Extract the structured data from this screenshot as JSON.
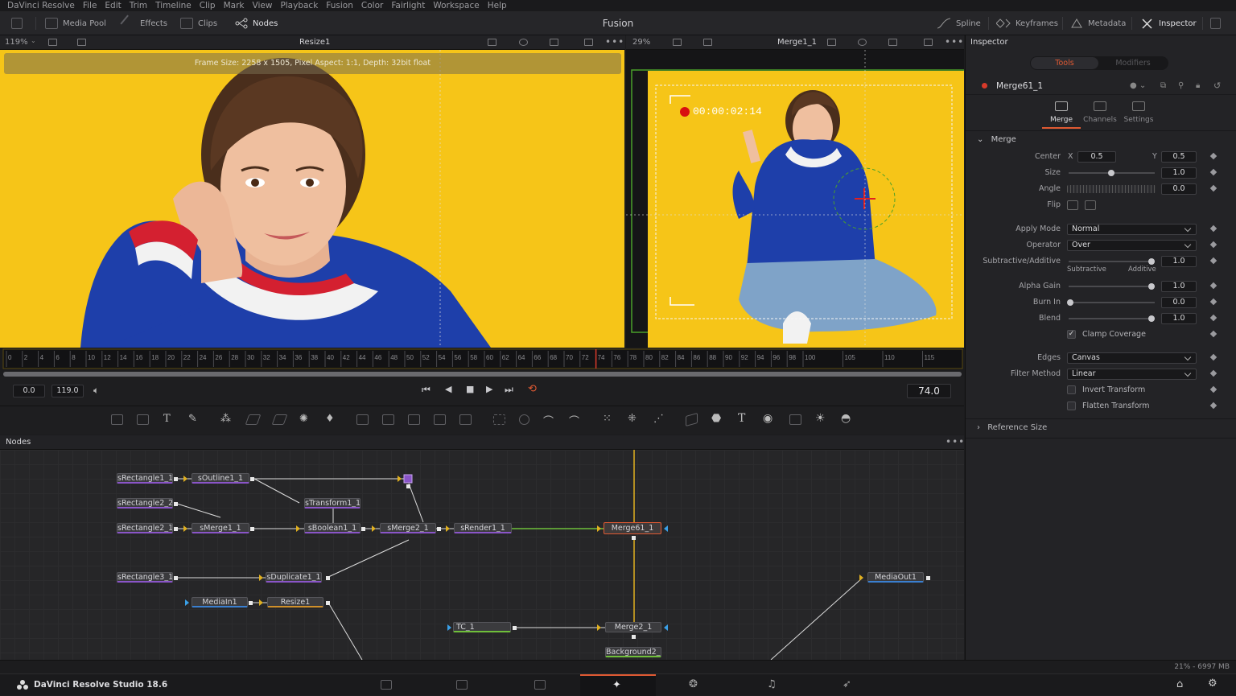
{
  "menu": [
    "DaVinci Resolve",
    "File",
    "Edit",
    "Trim",
    "Timeline",
    "Clip",
    "Mark",
    "View",
    "Playback",
    "Fusion",
    "Color",
    "Fairlight",
    "Workspace",
    "Help"
  ],
  "toolbar": {
    "media_pool": "Media Pool",
    "effects": "Effects",
    "clips": "Clips",
    "nodes": "Nodes",
    "title": "Fusion",
    "spline": "Spline",
    "keyframes": "Keyframes",
    "metadata": "Metadata",
    "inspector": "Inspector"
  },
  "viewer_left": {
    "zoom": "119%",
    "title": "Resize1",
    "frame_info": "Frame Size: 2258 x 1505, Pixel Aspect: 1:1, Depth: 32bit float"
  },
  "viewer_right": {
    "zoom": "29%",
    "title": "Merge1_1",
    "timecode": "00:00:02:14"
  },
  "timeline": {
    "ticks": [
      "0",
      "2",
      "4",
      "6",
      "8",
      "10",
      "12",
      "14",
      "16",
      "18",
      "20",
      "22",
      "24",
      "26",
      "28",
      "30",
      "32",
      "34",
      "36",
      "38",
      "40",
      "42",
      "44",
      "46",
      "48",
      "50",
      "52",
      "54",
      "56",
      "58",
      "60",
      "62",
      "64",
      "66",
      "68",
      "70",
      "72",
      "74",
      "76",
      "78",
      "80",
      "82",
      "84",
      "86",
      "88",
      "90",
      "92",
      "94",
      "96",
      "98",
      "100",
      "105",
      "110",
      "115"
    ],
    "playhead": 74
  },
  "transport": {
    "start": "0.0",
    "end": "119.0",
    "current": "74.0"
  },
  "nodes_panel": {
    "title": "Nodes",
    "nodes": {
      "srect1": "sRectangle1_1",
      "soutline": "sOutline1_1",
      "srect22": "sRectangle2_2",
      "stransform": "sTransform1_1",
      "srect21": "sRectangle2_1...",
      "smerge1": "sMerge1_1",
      "sboolean": "sBoolean1_1",
      "smerge2": "sMerge2_1",
      "srender": "sRender1_1",
      "merge61": "Merge61_1",
      "srect3": "sRectangle3_1",
      "sduplicate": "sDuplicate1_1",
      "mediain": "MediaIn1",
      "resize": "Resize1",
      "tc": "TC_1",
      "merge2": "Merge2_1",
      "background": "Background2_1",
      "mediaout": "MediaOut1"
    }
  },
  "inspector": {
    "title": "Inspector",
    "tab_tools": "Tools",
    "tab_modifiers": "Modifiers",
    "node_name": "Merge61_1",
    "subtab_merge": "Merge",
    "subtab_channels": "Channels",
    "subtab_settings": "Settings",
    "section_merge": "Merge",
    "center_label": "Center",
    "x_label": "X",
    "center_x": "0.5",
    "y_label": "Y",
    "center_y": "0.5",
    "size_label": "Size",
    "size": "1.0",
    "angle_label": "Angle",
    "angle": "0.0",
    "flip_label": "Flip",
    "apply_mode_label": "Apply Mode",
    "apply_mode": "Normal",
    "operator_label": "Operator",
    "operator": "Over",
    "subadd_label": "Subtractive/Additive",
    "subadd": "1.0",
    "subtractive": "Subtractive",
    "additive": "Additive",
    "alpha_gain_label": "Alpha Gain",
    "alpha_gain": "1.0",
    "burn_in_label": "Burn In",
    "burn_in": "0.0",
    "blend_label": "Blend",
    "blend": "1.0",
    "clamp_label": "Clamp Coverage",
    "edges_label": "Edges",
    "edges": "Canvas",
    "filter_label": "Filter Method",
    "filter": "Linear",
    "invert_label": "Invert Transform",
    "flatten_label": "Flatten Transform",
    "reference_size": "Reference Size"
  },
  "status": {
    "memory": "21% - 6997 MB"
  },
  "brand": "DaVinci Resolve Studio 18.6",
  "colors": {
    "accent": "#e05a33",
    "yellow_bg": "#f5c416",
    "sweater_blue": "#1f3fa8"
  }
}
